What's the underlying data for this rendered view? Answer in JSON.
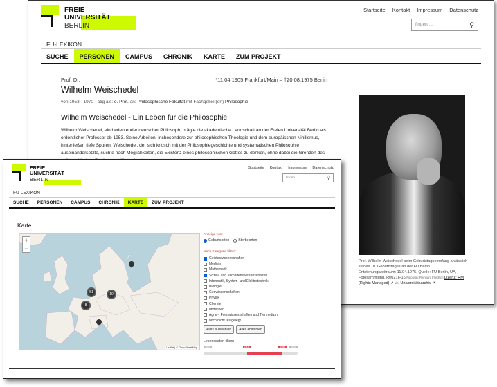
{
  "back": {
    "logo": {
      "line1": "FREIE",
      "line2": "UNIVERSITÄT",
      "line3": "BERLIN"
    },
    "topnav": [
      "Startseite",
      "Kontakt",
      "Impressum",
      "Datenschutz"
    ],
    "search_placeholder": "finden ...",
    "section": "FU-LEXIKON",
    "menu": [
      "SUCHE",
      "PERSONEN",
      "CAMPUS",
      "CHRONIK",
      "KARTE",
      "ZUM PROJEKT"
    ],
    "active_menu": "PERSONEN",
    "prof": "Prof. Dr.",
    "dates": "*11.04.1905 Frankfurt/Main – †20.08.1975 Berlin",
    "name": "Wilhelm Weischedel",
    "meta_prefix": "von 1953 - 1970 Tätig als:",
    "meta_role": "o. Prof.",
    "meta_an": "an:",
    "meta_faculty": "Philosophische Fakultät",
    "meta_mit": "mit Fachgebiet(en)",
    "meta_field": "Philosophie",
    "heading": "Wilhelm Weischedel - Ein Leben für die Philosophie",
    "para": "Wilhelm Weischedel, ein bedeutender deutscher Philosoph, prägte die akademische Landschaft an der Freien Universität Berlin als ordentlicher Professor ab 1953. Seine Arbeiten, insbesondere zur philosophischen Theologie und dem europäischen Nihilismus, hinterließen tiefe Spuren. Weischedel, der sich kritisch mit der Philosophiegeschichte und systematischen Philosophie auseinandersetzte, suchte nach Möglichkeiten, die Existenz eines philosophischen Gottes zu denken, ohne dabei die Grenzen des philosophischen Denkens zu überschreiten.",
    "caption_text": "Prof. Wilhelm Weischedel beim Geburtstagsempfang anlässlich seines 70. Geburtstages an der FU Berlin. Entstehungszeitraum: 11.04.1975, Quelle: FU Berlin, UA, Fotosammlung, Rf/0216-16",
    "caption_photo": "Foto von: Reinhard Friedrich",
    "caption_licence": "Lizenz: RM",
    "caption_rights": "(Rights Managed)",
    "caption_via": "via:",
    "caption_archive": "Universitätsarchiv"
  },
  "front": {
    "logo": {
      "line1": "FREIE",
      "line2": "UNIVERSITÄT",
      "line3": "BERLIN"
    },
    "topnav": [
      "Startseite",
      "Kontakt",
      "Impressum",
      "Datenschutz"
    ],
    "search_placeholder": "finden ...",
    "section": "FU-LEXIKON",
    "menu": [
      "SUCHE",
      "PERSONEN",
      "CAMPUS",
      "CHRONIK",
      "KARTE",
      "ZUM PROJEKT"
    ],
    "active_menu": "KARTE",
    "heading": "Karte",
    "map": {
      "zoom_in": "+",
      "zoom_out": "−",
      "clusters": [
        "51",
        "10",
        "8"
      ],
      "attribution": "Leaflet | © OpenStreetMap"
    },
    "display_label": "Anzeige von:",
    "radio": {
      "option1": "Geburtsorten",
      "option2": "Sterbeorten",
      "selected": "Geburtsorten"
    },
    "category_label": "Nach Kategorie filtern:",
    "categories": [
      {
        "label": "Geisteswissenschaften",
        "checked": true
      },
      {
        "label": "Medizin",
        "checked": false
      },
      {
        "label": "Mathematik",
        "checked": false
      },
      {
        "label": "Sozial- und Verhaltenswissenschaften",
        "checked": true
      },
      {
        "label": "Informatik, System- und Elektrotechnik",
        "checked": false
      },
      {
        "label": "Biologie",
        "checked": false
      },
      {
        "label": "Geowissenschaften",
        "checked": false
      },
      {
        "label": "Physik",
        "checked": false
      },
      {
        "label": "Chemie",
        "checked": false
      },
      {
        "label": "undefined",
        "checked": false
      },
      {
        "label": "Agrar-, Forstwissenschaften und Tiermedizin",
        "checked": false
      },
      {
        "label": "noch nicht festgelegt",
        "checked": false
      }
    ],
    "select_all": "Alles auswählen",
    "deselect_all": "Alles abwählen",
    "life_label": "Lebensdaten filtern",
    "slider": {
      "min_tag": "1800",
      "from": "1904",
      "to": "1985",
      "max_tag": "2024",
      "from_fraction": 0.46,
      "to_fraction": 0.84
    }
  },
  "colors": {
    "accent": "#cdfa00",
    "text": "#222222",
    "slider": "#e5404f",
    "water": "#b9d3dc",
    "land": "#f2efe9"
  }
}
